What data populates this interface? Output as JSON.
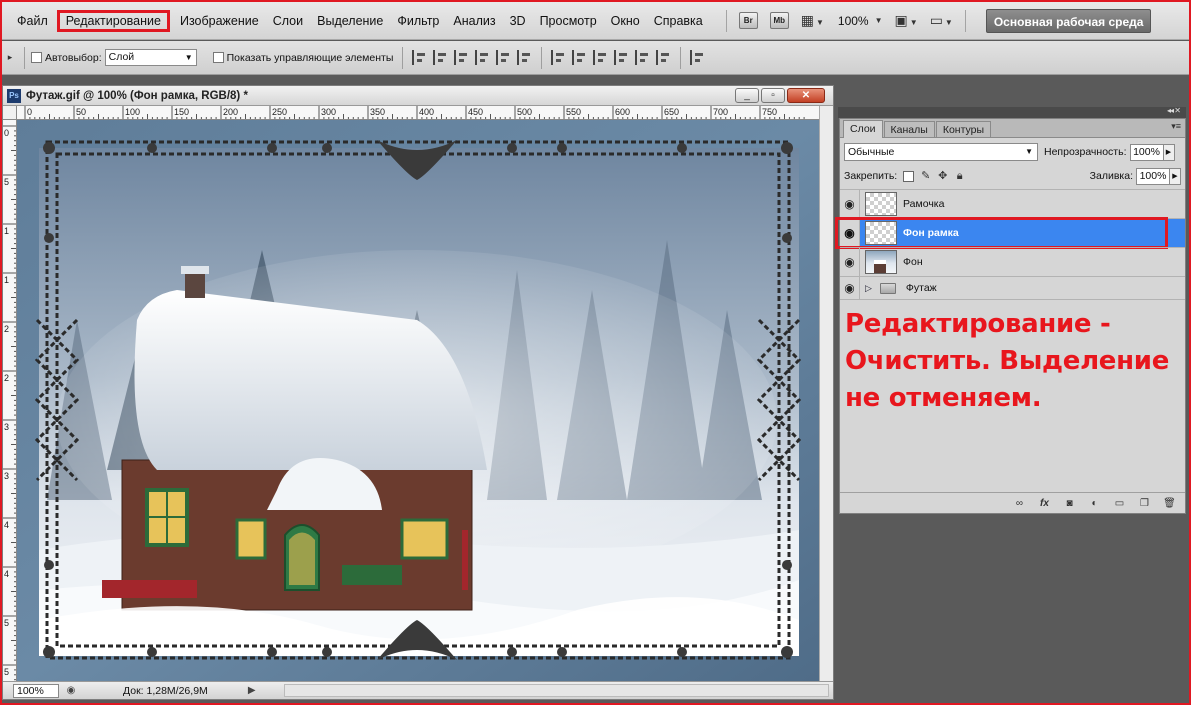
{
  "menubar": {
    "items": [
      "Файл",
      "Редактирование",
      "Изображение",
      "Слои",
      "Выделение",
      "Фильтр",
      "Анализ",
      "3D",
      "Просмотр",
      "Окно",
      "Справка"
    ],
    "highlighted": "Редактирование",
    "bridge_badge": "Br",
    "minibridge_badge": "Mb",
    "zoom": "100%",
    "workspace": "Основная рабочая среда"
  },
  "options": {
    "auto_select_label": "Автовыбор:",
    "auto_select_value": "Слой",
    "show_controls_label": "Показать управляющие элементы"
  },
  "document": {
    "title": "Футаж.gif @ 100% (Фон рамка, RGB/8) *",
    "ps_icon": "Ps",
    "ruler_h": [
      "0",
      "50",
      "100",
      "150",
      "200",
      "250",
      "300",
      "350",
      "400",
      "450",
      "500",
      "550",
      "600",
      "650",
      "700",
      "750"
    ],
    "ruler_v": [
      "0",
      "5",
      "1",
      "1",
      "2",
      "2",
      "3",
      "3",
      "4",
      "4",
      "5",
      "5"
    ],
    "zoom": "100%",
    "info": "Док: 1,28M/26,9M"
  },
  "layers_panel": {
    "tabs": [
      "Слои",
      "Каналы",
      "Контуры"
    ],
    "active_tab": "Слои",
    "blend_mode": "Обычные",
    "opacity_label": "Непрозрачность:",
    "opacity": "100%",
    "lock_label": "Закрепить:",
    "fill_label": "Заливка:",
    "fill": "100%",
    "layers": [
      {
        "name": "Рамочка",
        "selected": false
      },
      {
        "name": "Фон рамка",
        "selected": true
      },
      {
        "name": "Фон",
        "selected": false
      },
      {
        "name": "Футаж",
        "selected": false,
        "group": true
      }
    ]
  },
  "annotation": {
    "lines": [
      "Редактирование -",
      "Очистить. Выделение",
      "не отменяем."
    ]
  },
  "colors": {
    "highlight_red": "#e01822",
    "selection_blue": "#3b86f0",
    "annotation_red": "#e8161d"
  }
}
